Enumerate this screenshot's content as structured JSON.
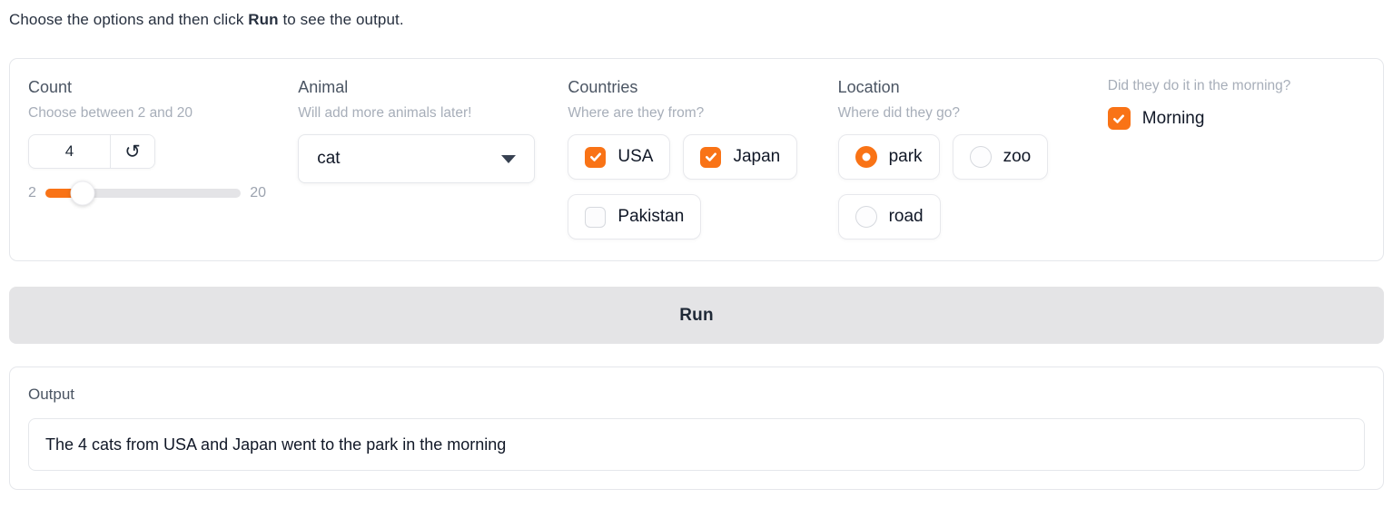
{
  "instruction": {
    "prefix": "Choose the options and then click ",
    "bold": "Run",
    "suffix": " to see the output."
  },
  "form": {
    "count": {
      "label": "Count",
      "info": "Choose between 2 and 20",
      "value": "4",
      "reset_icon": "↺",
      "slider": {
        "min": 2,
        "max": 20,
        "value": 4,
        "min_label": "2",
        "max_label": "20"
      }
    },
    "animal": {
      "label": "Animal",
      "info": "Will add more animals later!",
      "selected_value": "cat"
    },
    "countries": {
      "label": "Countries",
      "info": "Where are they from?",
      "options": [
        {
          "label": "USA",
          "checked": true
        },
        {
          "label": "Japan",
          "checked": true
        },
        {
          "label": "Pakistan",
          "checked": false
        }
      ]
    },
    "location": {
      "label": "Location",
      "info": "Where did they go?",
      "options": [
        {
          "label": "park",
          "selected": true
        },
        {
          "label": "zoo",
          "selected": false
        },
        {
          "label": "road",
          "selected": false
        }
      ]
    },
    "morning": {
      "info": "Did they do it in the morning?",
      "label": "Morning",
      "checked": true
    }
  },
  "run_button": {
    "label": "Run"
  },
  "output": {
    "label": "Output",
    "value": "The 4 cats from USA and Japan went to the park in the morning"
  },
  "colors": {
    "accent": "#f97316",
    "border": "#e5e7eb",
    "button_bg": "#e4e4e6",
    "info_text": "#a7aeb9"
  }
}
